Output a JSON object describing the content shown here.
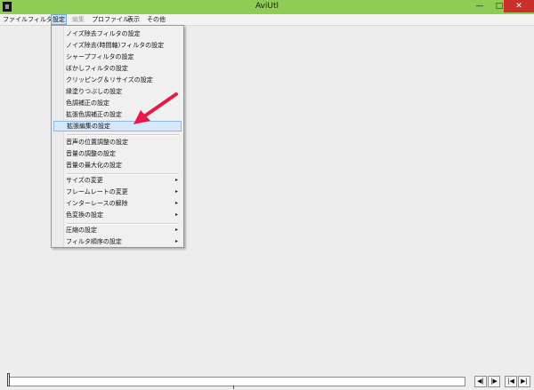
{
  "window": {
    "title": "AviUtl",
    "minimize_glyph": "—",
    "maximize_glyph": "□",
    "close_glyph": "✕"
  },
  "menubar": {
    "items": [
      {
        "label": "ファイル"
      },
      {
        "label": "フィルタ"
      },
      {
        "label": "設定"
      },
      {
        "label": "編集"
      },
      {
        "label": "プロファイル"
      },
      {
        "label": "表示"
      },
      {
        "label": "その他"
      }
    ]
  },
  "settings_menu": {
    "items": [
      {
        "label": "ノイズ除去フィルタの設定"
      },
      {
        "label": "ノイズ除去(時間軸)フィルタの設定"
      },
      {
        "label": "シャープフィルタの設定"
      },
      {
        "label": "ぼかしフィルタの設定"
      },
      {
        "label": "クリッピング＆リサイズの設定"
      },
      {
        "label": "縁塗りつぶしの設定"
      },
      {
        "label": "色調補正の設定"
      },
      {
        "label": "拡張色調補正の設定"
      },
      {
        "label": "拡張編集の設定"
      },
      {
        "label": "音声の位置調整の設定"
      },
      {
        "label": "音量の調整の設定"
      },
      {
        "label": "音量の最大化の設定"
      },
      {
        "label": "サイズの変更"
      },
      {
        "label": "フレームレートの変更"
      },
      {
        "label": "インターレースの解除"
      },
      {
        "label": "色変換の設定"
      },
      {
        "label": "圧縮の設定"
      },
      {
        "label": "フィルタ順序の設定"
      }
    ],
    "submenu_arrow": "▸",
    "highlighted_index": 8
  },
  "nav_buttons": {
    "prev_keyframe": "◀|",
    "next_keyframe": "|▶",
    "first_frame": "|◀",
    "last_frame": "▶|"
  },
  "colors": {
    "titlebar": "#8fcc55",
    "close_button": "#c7302b",
    "highlight": "#d7e8fa",
    "annotation_arrow": "#e8184a"
  }
}
